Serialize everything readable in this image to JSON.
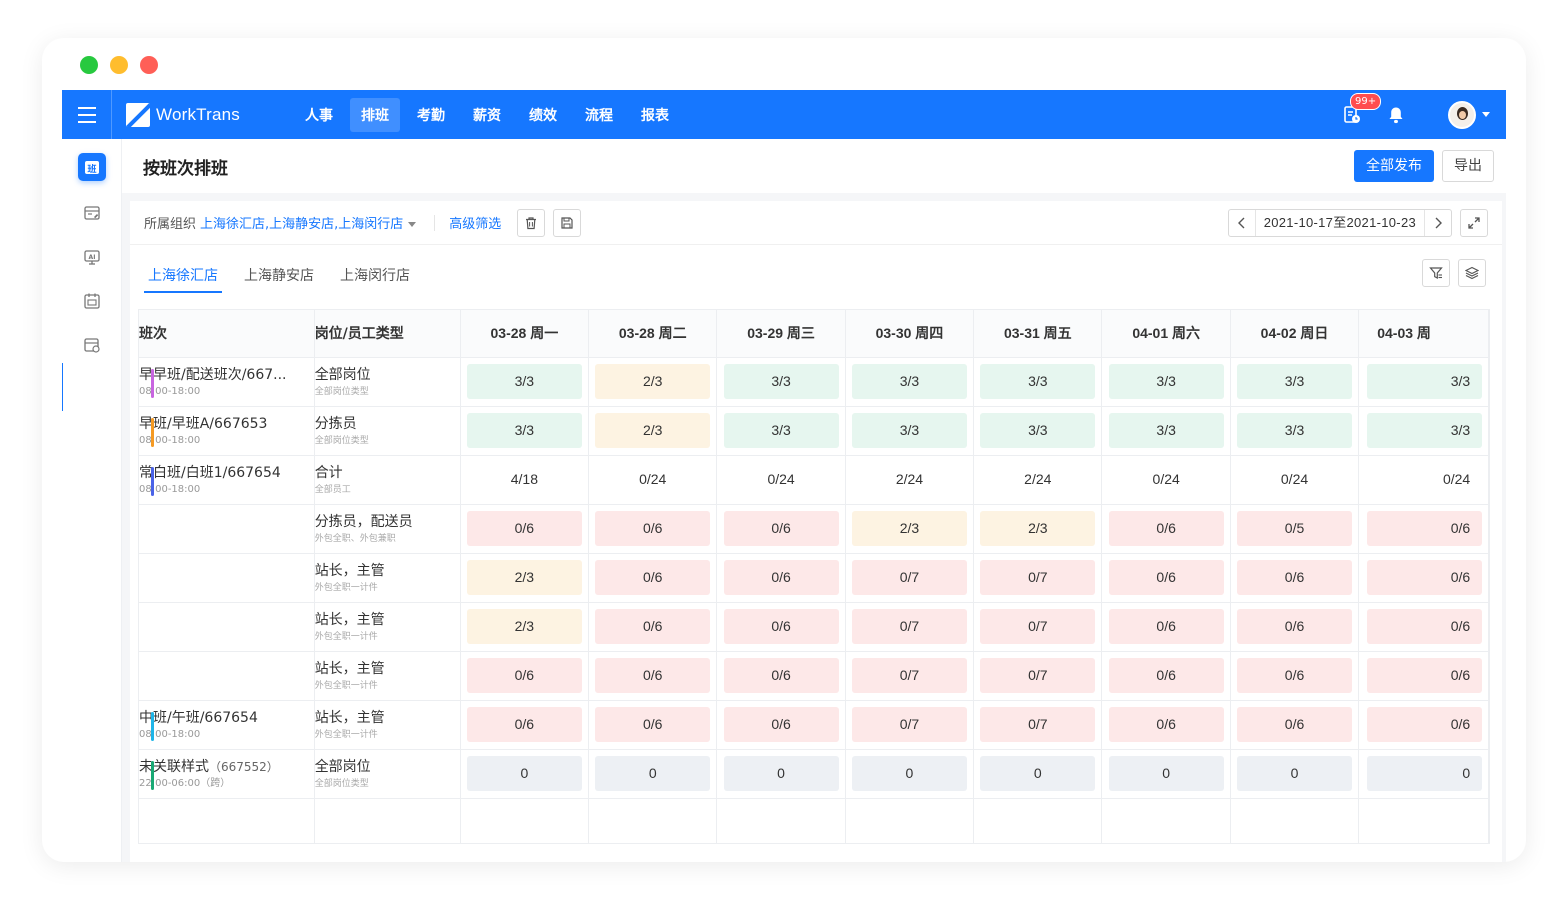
{
  "window": {
    "traffic_colors": [
      "#27c93f",
      "#ffbd2e",
      "#ff5f57"
    ]
  },
  "topbar": {
    "brand": "WorkTrans",
    "nav": [
      {
        "label": "人事",
        "active": false
      },
      {
        "label": "排班",
        "active": true
      },
      {
        "label": "考勤",
        "active": false
      },
      {
        "label": "薪资",
        "active": false
      },
      {
        "label": "绩效",
        "active": false
      },
      {
        "label": "流程",
        "active": false
      },
      {
        "label": "报表",
        "active": false
      }
    ],
    "task_badge": "99+",
    "accent": "#1677ff"
  },
  "sidebar": {
    "items": [
      {
        "icon": "schedule-icon",
        "active": true,
        "glyph": "班"
      },
      {
        "icon": "edit-calendar-icon",
        "active": false
      },
      {
        "icon": "ai-monitor-icon",
        "active": false
      },
      {
        "icon": "calendar-icon",
        "active": false
      },
      {
        "icon": "calendar-settings-icon",
        "active": false
      }
    ]
  },
  "header": {
    "title": "按班次排班",
    "publish_all": "全部发布",
    "export": "导出"
  },
  "filter": {
    "org_label": "所属组织",
    "org_value": "上海徐汇店,上海静安店,上海闵行店",
    "advanced": "高级筛选",
    "date_range": "2021-10-17至2021-10-23"
  },
  "tabs": [
    {
      "label": "上海徐汇店",
      "active": true
    },
    {
      "label": "上海静安店",
      "active": false
    },
    {
      "label": "上海闵行店",
      "active": false
    }
  ],
  "grid": {
    "col_shift": "班次",
    "col_position": "岗位/员工类型",
    "days": [
      "03-28  周一",
      "03-28  周二",
      "03-29  周三",
      "03-30  周四",
      "03-31  周五",
      "04-01  周六",
      "04-02  周日",
      "04-03  周"
    ],
    "rows": [
      {
        "shift": "早早班/配送班次/667...",
        "code": "",
        "time": "08:00-18:00",
        "bar": "#c865e0",
        "position": "全部岗位",
        "ptype": "全部岗位类型",
        "cells": [
          [
            "3/3",
            "green"
          ],
          [
            "2/3",
            "yellow"
          ],
          [
            "3/3",
            "green"
          ],
          [
            "3/3",
            "green"
          ],
          [
            "3/3",
            "green"
          ],
          [
            "3/3",
            "green"
          ],
          [
            "3/3",
            "green"
          ],
          [
            "3/3",
            "green"
          ]
        ]
      },
      {
        "shift": "早班/早班A/667653",
        "code": "",
        "time": "08:00-18:00",
        "bar": "#f59a23",
        "position": "分拣员",
        "ptype": "全部岗位类型",
        "cells": [
          [
            "3/3",
            "green"
          ],
          [
            "2/3",
            "yellow"
          ],
          [
            "3/3",
            "green"
          ],
          [
            "3/3",
            "green"
          ],
          [
            "3/3",
            "green"
          ],
          [
            "3/3",
            "green"
          ],
          [
            "3/3",
            "green"
          ],
          [
            "3/3",
            "green"
          ]
        ]
      },
      {
        "shift": "常白班/白班1/667654",
        "code": "",
        "time": "08:00-18:00",
        "bar": "#4a63e8",
        "position": "合计",
        "ptype": "全部员工",
        "cells": [
          [
            "4/18",
            "plain"
          ],
          [
            "0/24",
            "plain"
          ],
          [
            "0/24",
            "plain"
          ],
          [
            "2/24",
            "plain"
          ],
          [
            "2/24",
            "plain"
          ],
          [
            "0/24",
            "plain"
          ],
          [
            "0/24",
            "plain"
          ],
          [
            "0/24",
            "plain"
          ]
        ]
      },
      {
        "shift": "",
        "code": "",
        "time": "",
        "bar": "",
        "position": "分拣员，配送员",
        "ptype": "外包全职、外包兼职",
        "cells": [
          [
            "0/6",
            "red"
          ],
          [
            "0/6",
            "red"
          ],
          [
            "0/6",
            "red"
          ],
          [
            "2/3",
            "yellow"
          ],
          [
            "2/3",
            "yellow"
          ],
          [
            "0/6",
            "red"
          ],
          [
            "0/5",
            "red"
          ],
          [
            "0/6",
            "red"
          ]
        ]
      },
      {
        "shift": "",
        "code": "",
        "time": "",
        "bar": "",
        "position": "站长，主管",
        "ptype": "外包全职一计件",
        "cells": [
          [
            "2/3",
            "yellow"
          ],
          [
            "0/6",
            "red"
          ],
          [
            "0/6",
            "red"
          ],
          [
            "0/7",
            "red"
          ],
          [
            "0/7",
            "red"
          ],
          [
            "0/6",
            "red"
          ],
          [
            "0/6",
            "red"
          ],
          [
            "0/6",
            "red"
          ]
        ]
      },
      {
        "shift": "",
        "code": "",
        "time": "",
        "bar": "",
        "position": "站长，主管",
        "ptype": "外包全职一计件",
        "cells": [
          [
            "2/3",
            "yellow"
          ],
          [
            "0/6",
            "red"
          ],
          [
            "0/6",
            "red"
          ],
          [
            "0/7",
            "red"
          ],
          [
            "0/7",
            "red"
          ],
          [
            "0/6",
            "red"
          ],
          [
            "0/6",
            "red"
          ],
          [
            "0/6",
            "red"
          ]
        ]
      },
      {
        "shift": "",
        "code": "",
        "time": "",
        "bar": "",
        "position": "站长，主管",
        "ptype": "外包全职一计件",
        "cells": [
          [
            "0/6",
            "red"
          ],
          [
            "0/6",
            "red"
          ],
          [
            "0/6",
            "red"
          ],
          [
            "0/7",
            "red"
          ],
          [
            "0/7",
            "red"
          ],
          [
            "0/6",
            "red"
          ],
          [
            "0/6",
            "red"
          ],
          [
            "0/6",
            "red"
          ]
        ]
      },
      {
        "shift": "中班/午班/667654",
        "code": "",
        "time": "08:00-18:00",
        "bar": "#1fb5e8",
        "position": "站长，主管",
        "ptype": "外包全职一计件",
        "cells": [
          [
            "0/6",
            "red"
          ],
          [
            "0/6",
            "red"
          ],
          [
            "0/6",
            "red"
          ],
          [
            "0/7",
            "red"
          ],
          [
            "0/7",
            "red"
          ],
          [
            "0/6",
            "red"
          ],
          [
            "0/6",
            "red"
          ],
          [
            "0/6",
            "red"
          ]
        ]
      },
      {
        "shift": "未关联样式",
        "code": "（667552）",
        "time": "22:00-06:00（跨）",
        "bar": "#19a974",
        "position": "全部岗位",
        "ptype": "全部岗位类型",
        "cells": [
          [
            "0",
            "gray"
          ],
          [
            "0",
            "gray"
          ],
          [
            "0",
            "gray"
          ],
          [
            "0",
            "gray"
          ],
          [
            "0",
            "gray"
          ],
          [
            "0",
            "gray"
          ],
          [
            "0",
            "gray"
          ],
          [
            "0",
            "gray"
          ]
        ]
      }
    ]
  }
}
